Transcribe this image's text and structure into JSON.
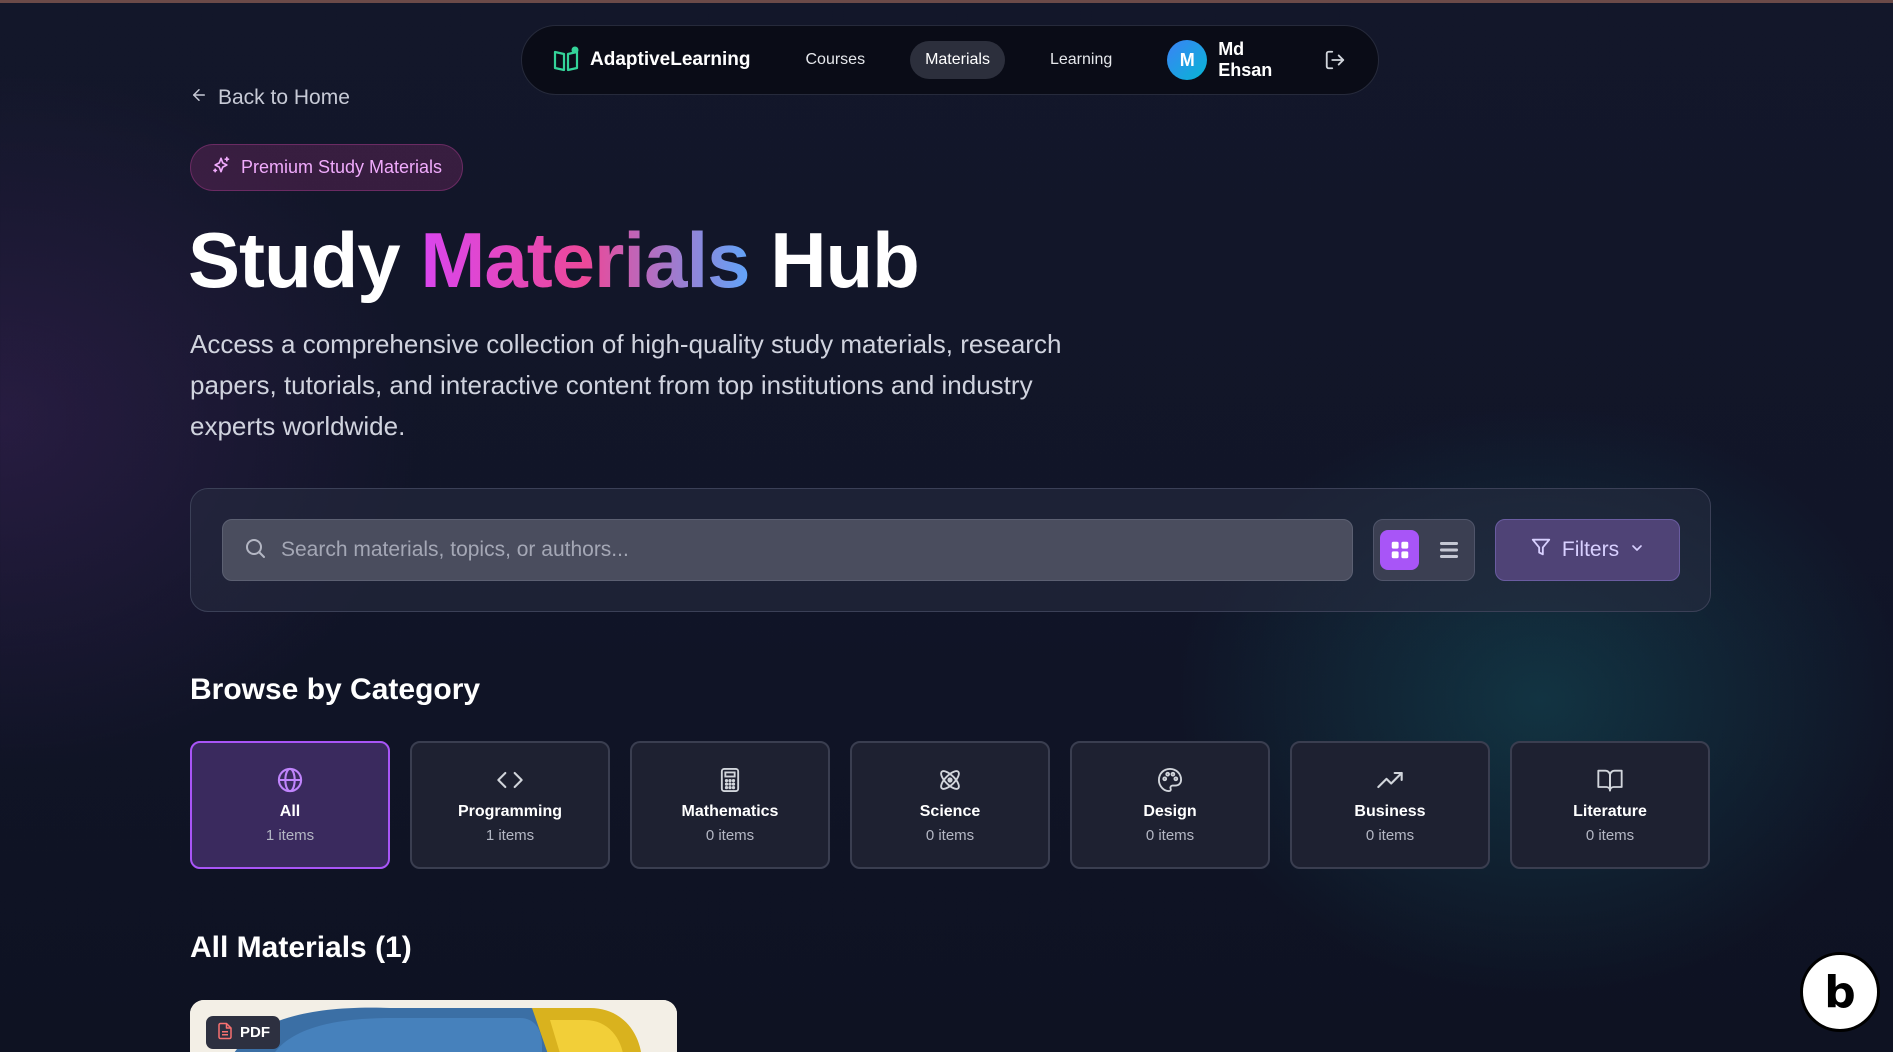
{
  "nav": {
    "brand": "AdaptiveLearning",
    "links": [
      "Courses",
      "Materials",
      "Learning"
    ],
    "active_link": "Materials",
    "user": {
      "initial": "M",
      "name": "Md Ehsan"
    }
  },
  "back_link": "Back to Home",
  "badge": "Premium Study Materials",
  "hero": {
    "title_part1": "Study",
    "title_highlight": "Materials",
    "title_part2": "Hub",
    "description": "Access a comprehensive collection of high-quality study materials, research papers, tutorials, and interactive content from top institutions and industry experts worldwide."
  },
  "search": {
    "placeholder": "Search materials, topics, or authors...",
    "value": ""
  },
  "view_mode": "grid",
  "filters_label": "Filters",
  "categories_title": "Browse by Category",
  "categories": [
    {
      "name": "All",
      "count": "1 items",
      "icon": "globe-icon",
      "active": true
    },
    {
      "name": "Programming",
      "count": "1 items",
      "icon": "code-icon",
      "active": false
    },
    {
      "name": "Mathematics",
      "count": "0 items",
      "icon": "calculator-icon",
      "active": false
    },
    {
      "name": "Science",
      "count": "0 items",
      "icon": "atom-icon",
      "active": false
    },
    {
      "name": "Design",
      "count": "0 items",
      "icon": "palette-icon",
      "active": false
    },
    {
      "name": "Business",
      "count": "0 items",
      "icon": "trending-up-icon",
      "active": false
    },
    {
      "name": "Literature",
      "count": "0 items",
      "icon": "book-open-icon",
      "active": false
    }
  ],
  "materials_title": "All Materials (1)",
  "materials": [
    {
      "type": "PDF"
    }
  ],
  "colors": {
    "accent": "#a855f7",
    "badge_text": "#f0abfc",
    "background": "#111528"
  }
}
